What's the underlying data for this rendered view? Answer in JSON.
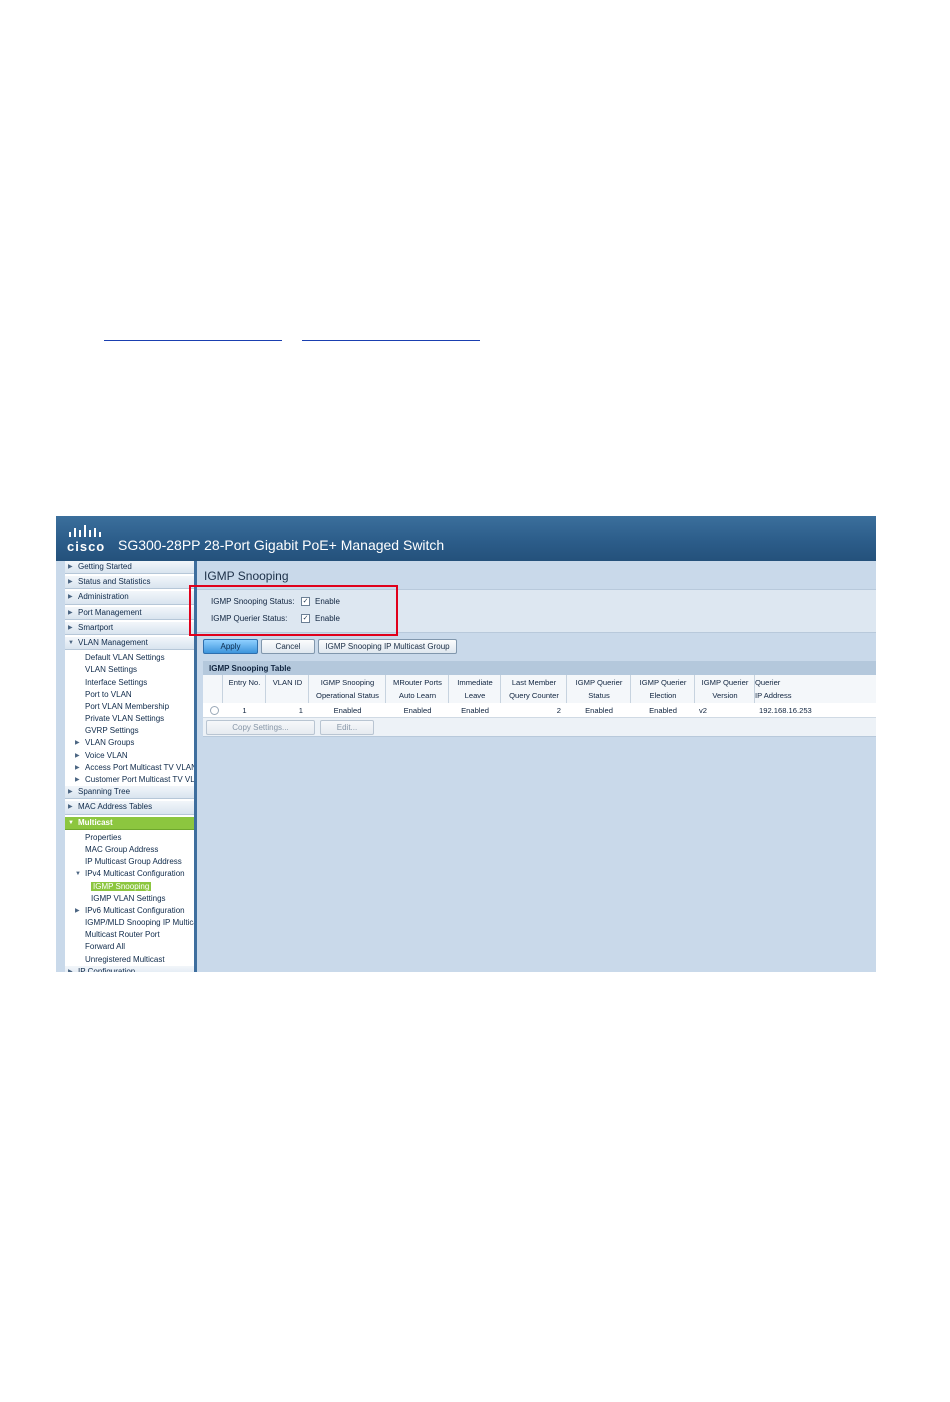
{
  "window": {
    "brand": "cisco",
    "title": "SG300-28PP 28-Port Gigabit PoE+ Managed Switch"
  },
  "sidebar": {
    "items": [
      {
        "label": "Getting Started",
        "level": 0
      },
      {
        "label": "Status and Statistics",
        "level": 0
      },
      {
        "label": "Administration",
        "level": 0
      },
      {
        "label": "Port Management",
        "level": 0
      },
      {
        "label": "Smartport",
        "level": 0
      },
      {
        "label": "VLAN Management",
        "level": 0,
        "expanded": true
      },
      {
        "label": "Default VLAN Settings",
        "level": 1
      },
      {
        "label": "VLAN Settings",
        "level": 1
      },
      {
        "label": "Interface Settings",
        "level": 1
      },
      {
        "label": "Port to VLAN",
        "level": 1
      },
      {
        "label": "Port VLAN Membership",
        "level": 1
      },
      {
        "label": "Private VLAN Settings",
        "level": 1
      },
      {
        "label": "GVRP Settings",
        "level": 1
      },
      {
        "label": "VLAN Groups",
        "level": 1
      },
      {
        "label": "Voice VLAN",
        "level": 1
      },
      {
        "label": "Access Port Multicast TV VLAN",
        "level": 1
      },
      {
        "label": "Customer Port Multicast TV VLAN",
        "level": 1
      },
      {
        "label": "Spanning Tree",
        "level": 0
      },
      {
        "label": "MAC Address Tables",
        "level": 0
      },
      {
        "label": "Multicast",
        "level": 0,
        "active": true
      },
      {
        "label": "Properties",
        "level": 1
      },
      {
        "label": "MAC Group Address",
        "level": 1
      },
      {
        "label": "IP Multicast Group Address",
        "level": 1
      },
      {
        "label": "IPv4 Multicast Configuration",
        "level": 1
      },
      {
        "label": "IGMP Snooping",
        "level": 2,
        "selected": true
      },
      {
        "label": "IGMP VLAN Settings",
        "level": 2
      },
      {
        "label": "IPv6 Multicast Configuration",
        "level": 1
      },
      {
        "label": "IGMP/MLD Snooping IP Multicast Group",
        "level": 1
      },
      {
        "label": "Multicast Router Port",
        "level": 1
      },
      {
        "label": "Forward All",
        "level": 1
      },
      {
        "label": "Unregistered Multicast",
        "level": 1
      },
      {
        "label": "IP Configuration",
        "level": 0
      }
    ]
  },
  "main": {
    "page_title": "IGMP Snooping",
    "settings": {
      "snooping_label": "IGMP Snooping Status:",
      "snooping_checked": true,
      "snooping_value": "Enable",
      "querier_label": "IGMP Querier Status:",
      "querier_checked": true,
      "querier_value": "Enable"
    },
    "buttons": {
      "apply": "Apply",
      "cancel": "Cancel",
      "group": "IGMP Snooping IP Multicast Group"
    },
    "table": {
      "title": "IGMP Snooping Table",
      "headers": [
        [
          "Entry No.",
          ""
        ],
        [
          "VLAN ID",
          ""
        ],
        [
          "IGMP Snooping",
          "Operational Status"
        ],
        [
          "MRouter Ports",
          "Auto Learn"
        ],
        [
          "Immediate",
          "Leave"
        ],
        [
          "Last Member",
          "Query Counter"
        ],
        [
          "IGMP Querier",
          "Status"
        ],
        [
          "IGMP Querier",
          "Election"
        ],
        [
          "IGMP Querier",
          "Version"
        ],
        [
          "Querier",
          "IP Address"
        ]
      ],
      "rows": [
        [
          "1",
          "1",
          "Enabled",
          "Enabled",
          "Enabled",
          "2",
          "Enabled",
          "Enabled",
          "v2",
          "192.168.16.253"
        ]
      ],
      "copy_button": "Copy Settings...",
      "edit_button": "Edit..."
    }
  },
  "colors": {
    "banner": "#2c5d8a",
    "active_nav": "#8cc63f",
    "highlight_box": "#e0001b"
  }
}
